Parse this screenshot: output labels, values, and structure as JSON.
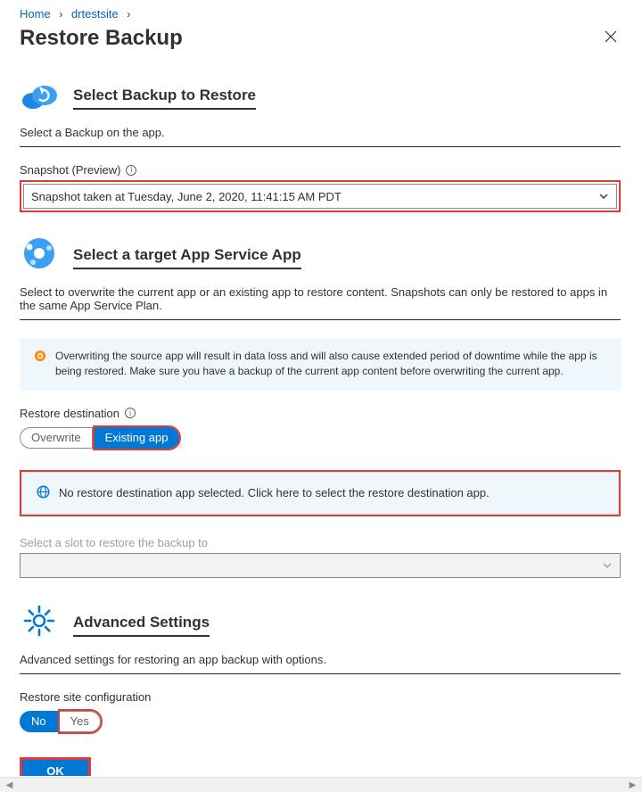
{
  "breadcrumb": {
    "home": "Home",
    "site": "drtestsite"
  },
  "page": {
    "title": "Restore Backup"
  },
  "section1": {
    "title": "Select Backup to Restore",
    "body": "Select a Backup on the app.",
    "snapshot_label": "Snapshot (Preview)",
    "snapshot_value": "Snapshot taken at Tuesday, June 2, 2020, 11:41:15 AM PDT"
  },
  "section2": {
    "title": "Select a target App Service App",
    "body": "Select to overwrite the current app or an existing app to restore content. Snapshots can only be restored to apps in the same App Service Plan.",
    "warning": "Overwriting the source app will result in data loss and will also cause extended period of downtime while the app is being restored. Make sure you have a backup of the current app content before overwriting the current app.",
    "restore_dest_label": "Restore destination",
    "overwrite": "Overwrite",
    "existing": "Existing app",
    "dest_placeholder": "No restore destination app selected. Click here to select the restore destination app.",
    "slot_label": "Select a slot to restore the backup to"
  },
  "section3": {
    "title": "Advanced Settings",
    "body": "Advanced settings for restoring an app backup with options.",
    "restore_config_label": "Restore site configuration",
    "no": "No",
    "yes": "Yes"
  },
  "buttons": {
    "ok": "OK"
  }
}
